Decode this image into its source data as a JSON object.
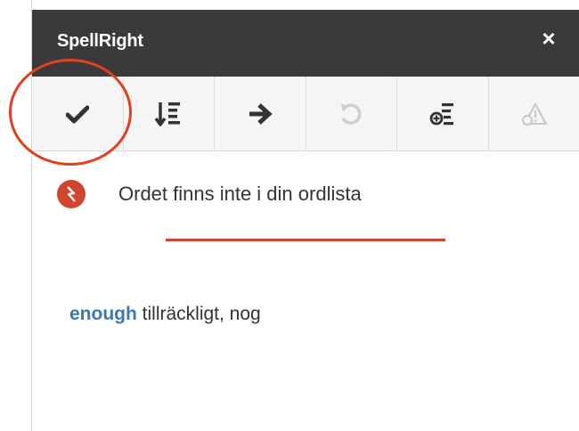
{
  "window": {
    "title": "SpellRight",
    "close_label": "×"
  },
  "toolbar": {
    "buttons": [
      {
        "icon": "checkmark-icon",
        "enabled": true
      },
      {
        "icon": "sort-list-icon",
        "enabled": true
      },
      {
        "icon": "arrow-right-icon",
        "enabled": true
      },
      {
        "icon": "undo-icon",
        "enabled": false
      },
      {
        "icon": "add-to-dictionary-icon",
        "enabled": true
      },
      {
        "icon": "warning-icon",
        "enabled": false
      }
    ]
  },
  "status": {
    "message": "Ordet finns inte i din ordlista"
  },
  "suggestion": {
    "word": "enough",
    "translation": " tillräckligt, nog"
  },
  "colors": {
    "titlebar": "#3a3a3a",
    "error": "#d0452f",
    "link": "#3b78b5",
    "highlight": "#e2401f"
  }
}
